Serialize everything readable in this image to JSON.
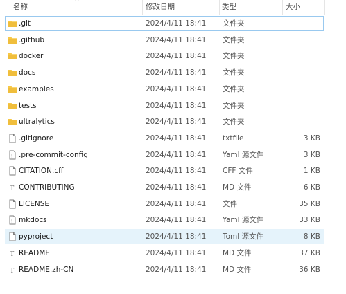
{
  "columns": {
    "name": "名称",
    "date": "修改日期",
    "type": "类型",
    "size": "大小"
  },
  "rows": [
    {
      "name": ".git",
      "date": "2024/4/11 18:41",
      "type": "文件夹",
      "size": "",
      "icon": "folder-icon"
    },
    {
      "name": ".github",
      "date": "2024/4/11 18:41",
      "type": "文件夹",
      "size": "",
      "icon": "folder-icon"
    },
    {
      "name": "docker",
      "date": "2024/4/11 18:41",
      "type": "文件夹",
      "size": "",
      "icon": "folder-icon"
    },
    {
      "name": "docs",
      "date": "2024/4/11 18:41",
      "type": "文件夹",
      "size": "",
      "icon": "folder-icon"
    },
    {
      "name": "examples",
      "date": "2024/4/11 18:41",
      "type": "文件夹",
      "size": "",
      "icon": "folder-icon"
    },
    {
      "name": "tests",
      "date": "2024/4/11 18:41",
      "type": "文件夹",
      "size": "",
      "icon": "folder-icon"
    },
    {
      "name": "ultralytics",
      "date": "2024/4/11 18:41",
      "type": "文件夹",
      "size": "",
      "icon": "folder-icon"
    },
    {
      "name": ".gitignore",
      "date": "2024/4/11 18:41",
      "type": "txtfile",
      "size": "3 KB",
      "icon": "file-icon"
    },
    {
      "name": ".pre-commit-config",
      "date": "2024/4/11 18:41",
      "type": "Yaml 源文件",
      "size": "3 KB",
      "icon": "code-file-icon"
    },
    {
      "name": "CITATION.cff",
      "date": "2024/4/11 18:41",
      "type": "CFF 文件",
      "size": "1 KB",
      "icon": "file-icon"
    },
    {
      "name": "CONTRIBUTING",
      "date": "2024/4/11 18:41",
      "type": "MD 文件",
      "size": "6 KB",
      "icon": "markdown-file-icon"
    },
    {
      "name": "LICENSE",
      "date": "2024/4/11 18:41",
      "type": "文件",
      "size": "35 KB",
      "icon": "file-icon"
    },
    {
      "name": "mkdocs",
      "date": "2024/4/11 18:41",
      "type": "Yaml 源文件",
      "size": "33 KB",
      "icon": "code-file-icon"
    },
    {
      "name": "pyproject",
      "date": "2024/4/11 18:41",
      "type": "Toml 源文件",
      "size": "8 KB",
      "icon": "file-icon"
    },
    {
      "name": "README",
      "date": "2024/4/11 18:41",
      "type": "MD 文件",
      "size": "37 KB",
      "icon": "markdown-file-icon"
    },
    {
      "name": "README.zh-CN",
      "date": "2024/4/11 18:41",
      "type": "MD 文件",
      "size": "36 KB",
      "icon": "markdown-file-icon"
    }
  ],
  "colors": {
    "folder": "#f7c846",
    "folder_dark": "#e3ad2b",
    "focus_border": "#99c9ef",
    "hover_bg": "#e5f3fb"
  }
}
